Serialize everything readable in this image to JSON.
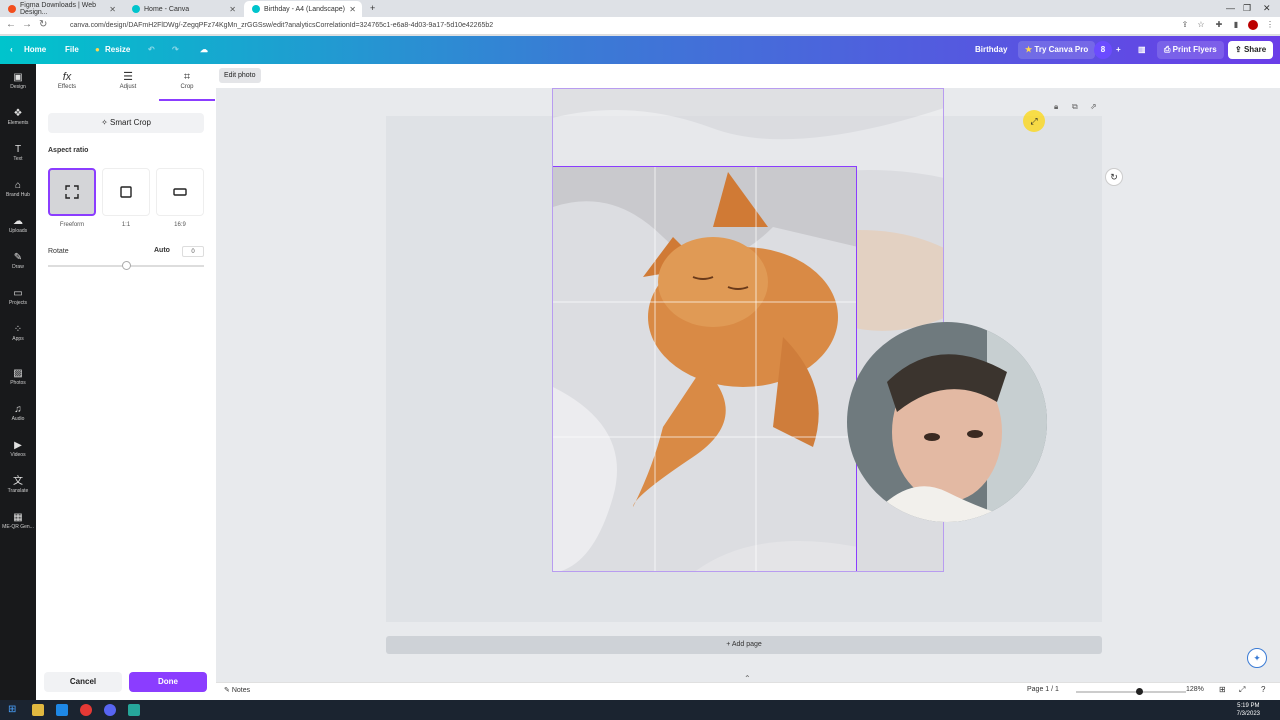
{
  "browser": {
    "tabs": [
      {
        "title": "Figma Downloads | Web Design..."
      },
      {
        "title": "Home - Canva"
      },
      {
        "title": "Birthday - A4 (Landscape)"
      }
    ],
    "url": "canva.com/design/DAFmH2FlDWg/-ZegqPFz74KgMn_zrGGSsw/edit?analyticsCorrelationId=324765c1-e6a8-4d03-9a17-5d10e42265b2"
  },
  "header": {
    "home": "Home",
    "file": "File",
    "resize": "Resize",
    "doc_title": "Birthday",
    "try_pro": "Try Canva Pro",
    "collab_count": "8",
    "print": "Print Flyers",
    "share": "Share"
  },
  "rail": {
    "items": [
      {
        "label": "Design",
        "icon": "design-icon"
      },
      {
        "label": "Elements",
        "icon": "elements-icon"
      },
      {
        "label": "Text",
        "icon": "text-icon"
      },
      {
        "label": "Brand Hub",
        "icon": "brand-hub-icon"
      },
      {
        "label": "Uploads",
        "icon": "uploads-icon"
      },
      {
        "label": "Draw",
        "icon": "draw-icon"
      },
      {
        "label": "Projects",
        "icon": "projects-icon"
      },
      {
        "label": "Apps",
        "icon": "apps-icon"
      },
      {
        "label": "Photos",
        "icon": "photos-icon"
      },
      {
        "label": "Audio",
        "icon": "audio-icon"
      },
      {
        "label": "Videos",
        "icon": "videos-icon"
      },
      {
        "label": "Translate",
        "icon": "translate-icon"
      },
      {
        "label": "ME-QR Gen...",
        "icon": "me-qr-icon"
      }
    ]
  },
  "panel": {
    "tabs": [
      {
        "label": "Effects"
      },
      {
        "label": "Adjust"
      },
      {
        "label": "Crop"
      }
    ],
    "smart_crop": "Smart Crop",
    "aspect_ratio_label": "Aspect ratio",
    "ratios": [
      {
        "label": "Freeform"
      },
      {
        "label": "1:1"
      },
      {
        "label": "16:9"
      }
    ],
    "rotate_label": "Rotate",
    "rotate_auto": "Auto",
    "rotate_value": "0",
    "cancel": "Cancel",
    "done": "Done"
  },
  "workspace": {
    "edit_photo": "Edit photo",
    "add_page": "+ Add page"
  },
  "bottombar": {
    "notes": "Notes",
    "page_info": "Page 1 / 1",
    "zoom": "128%"
  },
  "taskbar": {
    "time": "5:19 PM",
    "date": "7/3/2023"
  },
  "colors": {
    "accent": "#8b3dff",
    "header_gradient_start": "#00c4cc",
    "header_gradient_end": "#6a3de8"
  }
}
